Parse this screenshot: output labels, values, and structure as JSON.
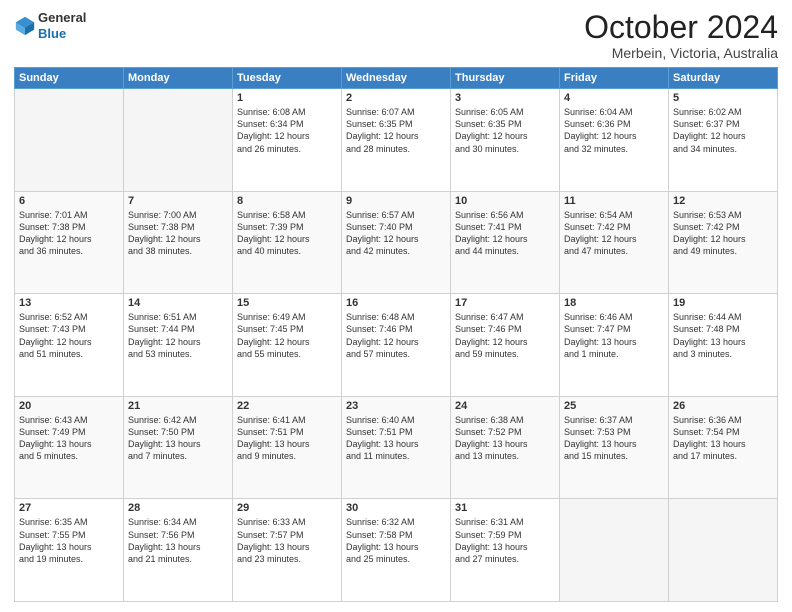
{
  "logo": {
    "general": "General",
    "blue": "Blue"
  },
  "header": {
    "month": "October 2024",
    "location": "Merbein, Victoria, Australia"
  },
  "days": [
    "Sunday",
    "Monday",
    "Tuesday",
    "Wednesday",
    "Thursday",
    "Friday",
    "Saturday"
  ],
  "weeks": [
    [
      {
        "day": "",
        "content": ""
      },
      {
        "day": "",
        "content": ""
      },
      {
        "day": "1",
        "content": "Sunrise: 6:08 AM\nSunset: 6:34 PM\nDaylight: 12 hours\nand 26 minutes."
      },
      {
        "day": "2",
        "content": "Sunrise: 6:07 AM\nSunset: 6:35 PM\nDaylight: 12 hours\nand 28 minutes."
      },
      {
        "day": "3",
        "content": "Sunrise: 6:05 AM\nSunset: 6:35 PM\nDaylight: 12 hours\nand 30 minutes."
      },
      {
        "day": "4",
        "content": "Sunrise: 6:04 AM\nSunset: 6:36 PM\nDaylight: 12 hours\nand 32 minutes."
      },
      {
        "day": "5",
        "content": "Sunrise: 6:02 AM\nSunset: 6:37 PM\nDaylight: 12 hours\nand 34 minutes."
      }
    ],
    [
      {
        "day": "6",
        "content": "Sunrise: 7:01 AM\nSunset: 7:38 PM\nDaylight: 12 hours\nand 36 minutes."
      },
      {
        "day": "7",
        "content": "Sunrise: 7:00 AM\nSunset: 7:38 PM\nDaylight: 12 hours\nand 38 minutes."
      },
      {
        "day": "8",
        "content": "Sunrise: 6:58 AM\nSunset: 7:39 PM\nDaylight: 12 hours\nand 40 minutes."
      },
      {
        "day": "9",
        "content": "Sunrise: 6:57 AM\nSunset: 7:40 PM\nDaylight: 12 hours\nand 42 minutes."
      },
      {
        "day": "10",
        "content": "Sunrise: 6:56 AM\nSunset: 7:41 PM\nDaylight: 12 hours\nand 44 minutes."
      },
      {
        "day": "11",
        "content": "Sunrise: 6:54 AM\nSunset: 7:42 PM\nDaylight: 12 hours\nand 47 minutes."
      },
      {
        "day": "12",
        "content": "Sunrise: 6:53 AM\nSunset: 7:42 PM\nDaylight: 12 hours\nand 49 minutes."
      }
    ],
    [
      {
        "day": "13",
        "content": "Sunrise: 6:52 AM\nSunset: 7:43 PM\nDaylight: 12 hours\nand 51 minutes."
      },
      {
        "day": "14",
        "content": "Sunrise: 6:51 AM\nSunset: 7:44 PM\nDaylight: 12 hours\nand 53 minutes."
      },
      {
        "day": "15",
        "content": "Sunrise: 6:49 AM\nSunset: 7:45 PM\nDaylight: 12 hours\nand 55 minutes."
      },
      {
        "day": "16",
        "content": "Sunrise: 6:48 AM\nSunset: 7:46 PM\nDaylight: 12 hours\nand 57 minutes."
      },
      {
        "day": "17",
        "content": "Sunrise: 6:47 AM\nSunset: 7:46 PM\nDaylight: 12 hours\nand 59 minutes."
      },
      {
        "day": "18",
        "content": "Sunrise: 6:46 AM\nSunset: 7:47 PM\nDaylight: 13 hours\nand 1 minute."
      },
      {
        "day": "19",
        "content": "Sunrise: 6:44 AM\nSunset: 7:48 PM\nDaylight: 13 hours\nand 3 minutes."
      }
    ],
    [
      {
        "day": "20",
        "content": "Sunrise: 6:43 AM\nSunset: 7:49 PM\nDaylight: 13 hours\nand 5 minutes."
      },
      {
        "day": "21",
        "content": "Sunrise: 6:42 AM\nSunset: 7:50 PM\nDaylight: 13 hours\nand 7 minutes."
      },
      {
        "day": "22",
        "content": "Sunrise: 6:41 AM\nSunset: 7:51 PM\nDaylight: 13 hours\nand 9 minutes."
      },
      {
        "day": "23",
        "content": "Sunrise: 6:40 AM\nSunset: 7:51 PM\nDaylight: 13 hours\nand 11 minutes."
      },
      {
        "day": "24",
        "content": "Sunrise: 6:38 AM\nSunset: 7:52 PM\nDaylight: 13 hours\nand 13 minutes."
      },
      {
        "day": "25",
        "content": "Sunrise: 6:37 AM\nSunset: 7:53 PM\nDaylight: 13 hours\nand 15 minutes."
      },
      {
        "day": "26",
        "content": "Sunrise: 6:36 AM\nSunset: 7:54 PM\nDaylight: 13 hours\nand 17 minutes."
      }
    ],
    [
      {
        "day": "27",
        "content": "Sunrise: 6:35 AM\nSunset: 7:55 PM\nDaylight: 13 hours\nand 19 minutes."
      },
      {
        "day": "28",
        "content": "Sunrise: 6:34 AM\nSunset: 7:56 PM\nDaylight: 13 hours\nand 21 minutes."
      },
      {
        "day": "29",
        "content": "Sunrise: 6:33 AM\nSunset: 7:57 PM\nDaylight: 13 hours\nand 23 minutes."
      },
      {
        "day": "30",
        "content": "Sunrise: 6:32 AM\nSunset: 7:58 PM\nDaylight: 13 hours\nand 25 minutes."
      },
      {
        "day": "31",
        "content": "Sunrise: 6:31 AM\nSunset: 7:59 PM\nDaylight: 13 hours\nand 27 minutes."
      },
      {
        "day": "",
        "content": ""
      },
      {
        "day": "",
        "content": ""
      }
    ]
  ]
}
